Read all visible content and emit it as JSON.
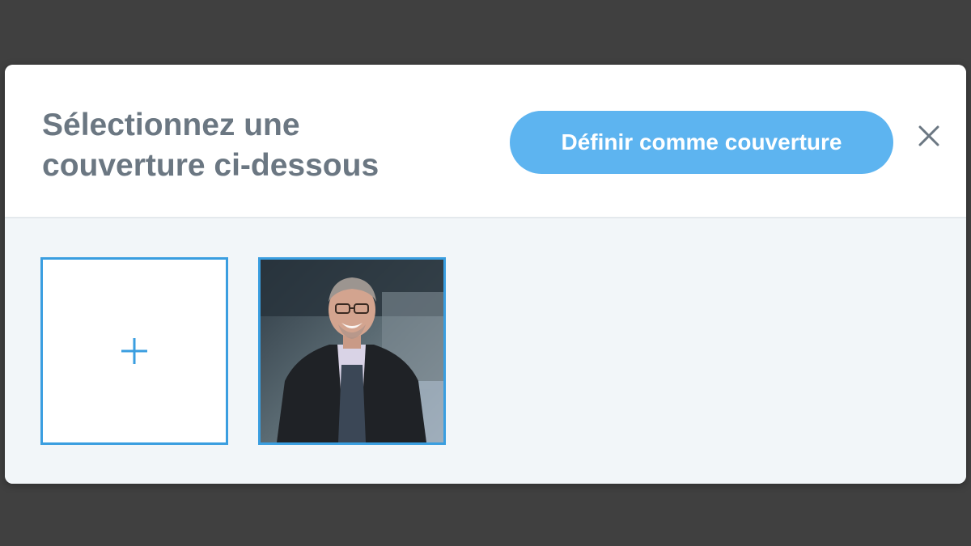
{
  "modal": {
    "title_line1": "Sélectionnez une",
    "title_line2": "couverture ci-dessous",
    "primary_button_label": "Définir comme couverture",
    "close_icon": "close-icon"
  },
  "thumbnails": [
    {
      "type": "add",
      "icon": "plus-icon"
    },
    {
      "type": "photo",
      "description_icon": "portrait-photo",
      "selected": true
    }
  ],
  "colors": {
    "backdrop": "#404040",
    "title": "#6b7782",
    "button": "#5db4f0",
    "thumb_border": "#3a9ee0",
    "body_bg": "#f2f6f9"
  }
}
